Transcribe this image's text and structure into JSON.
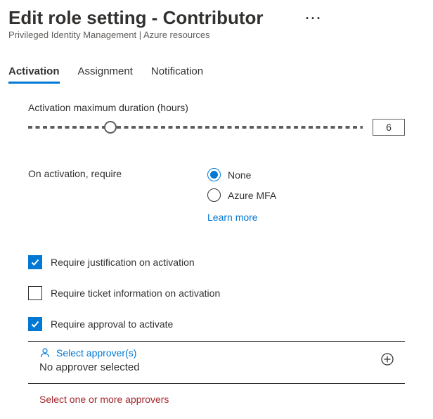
{
  "header": {
    "title": "Edit role setting - Contributor",
    "subtitle": "Privileged Identity Management | Azure resources"
  },
  "tabs": {
    "items": [
      {
        "label": "Activation",
        "active": true
      },
      {
        "label": "Assignment",
        "active": false
      },
      {
        "label": "Notification",
        "active": false
      }
    ]
  },
  "activation": {
    "duration_label": "Activation maximum duration (hours)",
    "duration_value": "6",
    "require_label": "On activation, require",
    "radios": {
      "none": "None",
      "mfa": "Azure MFA",
      "selected": "none"
    },
    "learn_more": "Learn more",
    "checkboxes": {
      "justification": {
        "label": "Require justification on activation",
        "checked": true
      },
      "ticket": {
        "label": "Require ticket information on activation",
        "checked": false
      },
      "approval": {
        "label": "Require approval to activate",
        "checked": true
      }
    },
    "approvers": {
      "select_label": "Select approver(s)",
      "status": "No approver selected",
      "validation": "Select one or more approvers"
    }
  }
}
